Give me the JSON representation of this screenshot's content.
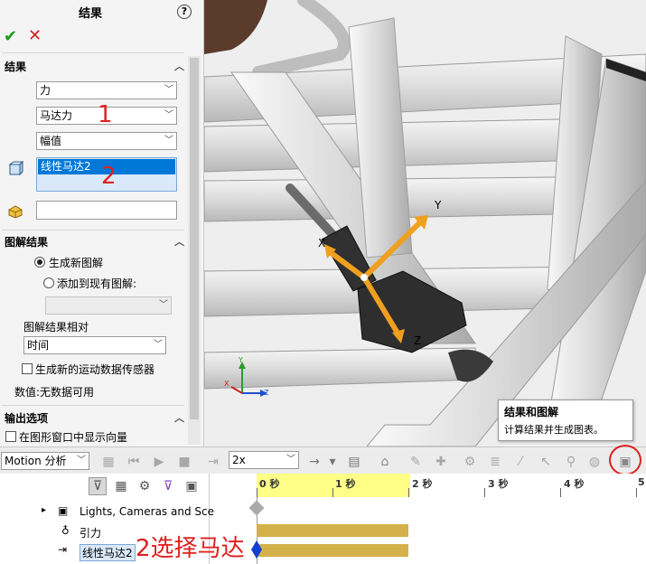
{
  "panel": {
    "title": "结果",
    "help": "?",
    "ok_icon": "check-icon",
    "cancel_icon": "x-icon",
    "results_section": "结果",
    "dropdown1": "力",
    "dropdown2": "马达力",
    "dropdown3": "幅值",
    "list_selected": "线性马达2",
    "annot1": "1",
    "annot2": "2",
    "plot_section": "图解结果",
    "radio_new": "生成新图解",
    "radio_add": "添加到现有图解:",
    "plot_relative": "图解结果相对",
    "relative_value": "时间",
    "sensor_check": "生成新的运动数据传感器",
    "value_text": "数值:无数据可用",
    "output_section": "输出选项",
    "vector_check": "在图形窗口中显示向量"
  },
  "viewport": {
    "axis_y": "Y",
    "axis_x": "X",
    "axis_z": "Z",
    "triad_y": "Y",
    "triad_x": "X",
    "triad_z": "Z"
  },
  "tooltip": {
    "title": "结果和图解",
    "desc": "计算结果并生成图表。"
  },
  "toolbar": {
    "study_type": "Motion 分析",
    "speed": "2x"
  },
  "tree": {
    "row1": "Lights, Cameras and Sce",
    "row2": "引力",
    "row3": "线性马达2",
    "annot": "2选择马达"
  },
  "timeline": {
    "t0": "0 秒",
    "t1": "1 秒",
    "t2": "2 秒",
    "t3": "3 秒",
    "t4": "4 秒",
    "t5": "5"
  },
  "colors": {
    "annotation_red": "#e02020",
    "selection_blue": "#0078d7",
    "timeline_yellow": "#ffff88",
    "bar_gold": "#d4b14a",
    "arrow_orange": "#f0a020"
  }
}
